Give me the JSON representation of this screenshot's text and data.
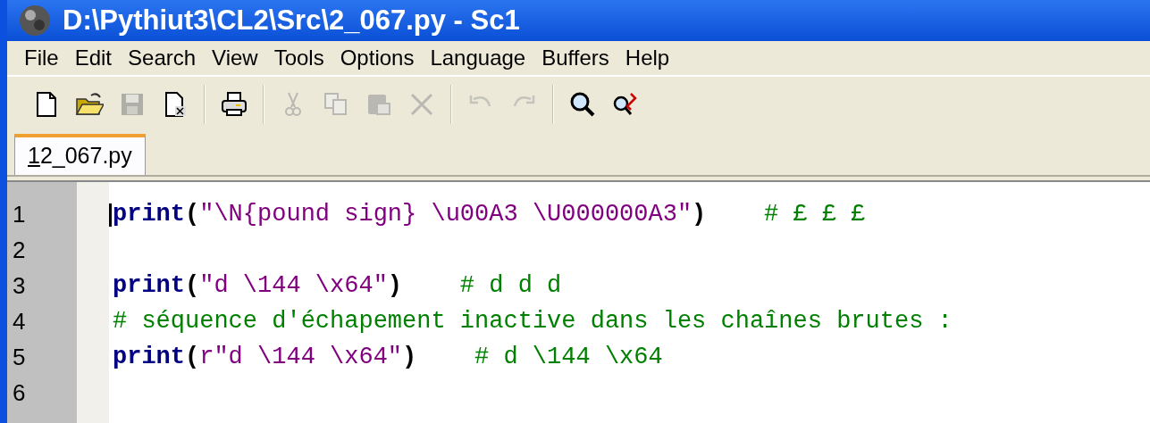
{
  "window": {
    "title": "D:\\Pythiut3\\CL2\\Src\\2_067.py - Sc1"
  },
  "menu": [
    "File",
    "Edit",
    "Search",
    "View",
    "Tools",
    "Options",
    "Language",
    "Buffers",
    "Help"
  ],
  "toolbar": [
    {
      "kind": "new",
      "disabled": false
    },
    {
      "kind": "open",
      "disabled": false
    },
    {
      "kind": "save",
      "disabled": true
    },
    {
      "kind": "close",
      "disabled": false
    },
    {
      "kind": "separator"
    },
    {
      "kind": "print",
      "disabled": false
    },
    {
      "kind": "separator"
    },
    {
      "kind": "cut",
      "disabled": true
    },
    {
      "kind": "copy",
      "disabled": true
    },
    {
      "kind": "paste",
      "disabled": true
    },
    {
      "kind": "delete",
      "disabled": true
    },
    {
      "kind": "separator"
    },
    {
      "kind": "undo",
      "disabled": true
    },
    {
      "kind": "redo",
      "disabled": true
    },
    {
      "kind": "separator"
    },
    {
      "kind": "find",
      "disabled": false
    },
    {
      "kind": "replace",
      "disabled": false
    }
  ],
  "tabs": [
    {
      "accelerator": "1",
      "label": "2_067.py",
      "selected": true
    }
  ],
  "editor": {
    "lines": [
      {
        "number": "1",
        "tokens": [
          {
            "kind": "keyword",
            "text": "print"
          },
          {
            "kind": "operator",
            "text": "("
          },
          {
            "kind": "string",
            "text": "\"\\N{pound sign} \\u00A3 \\U000000A3\""
          },
          {
            "kind": "operator",
            "text": ")"
          },
          {
            "kind": "comment",
            "text": "# £ £ £"
          }
        ]
      },
      {
        "number": "2"
      },
      {
        "number": "3",
        "tokens": [
          {
            "kind": "keyword",
            "text": "print"
          },
          {
            "kind": "operator",
            "text": "("
          },
          {
            "kind": "string",
            "text": "\"d \\144 \\x64\""
          },
          {
            "kind": "operator",
            "text": ")"
          },
          {
            "kind": "comment",
            "text": "# d d d"
          }
        ]
      },
      {
        "number": "4",
        "tokens": [
          {
            "kind": "comment",
            "text": "# séquence d'échapement inactive dans les chaînes brutes :"
          }
        ]
      },
      {
        "number": "5",
        "tokens": [
          {
            "kind": "keyword",
            "text": "print"
          },
          {
            "kind": "operator",
            "text": "("
          },
          {
            "kind": "string",
            "text": "r\"d \\144 \\x64\""
          },
          {
            "kind": "operator",
            "text": ")"
          },
          {
            "kind": "comment",
            "text": "# d \\144 \\x64"
          }
        ]
      },
      {
        "number": "6"
      }
    ]
  }
}
